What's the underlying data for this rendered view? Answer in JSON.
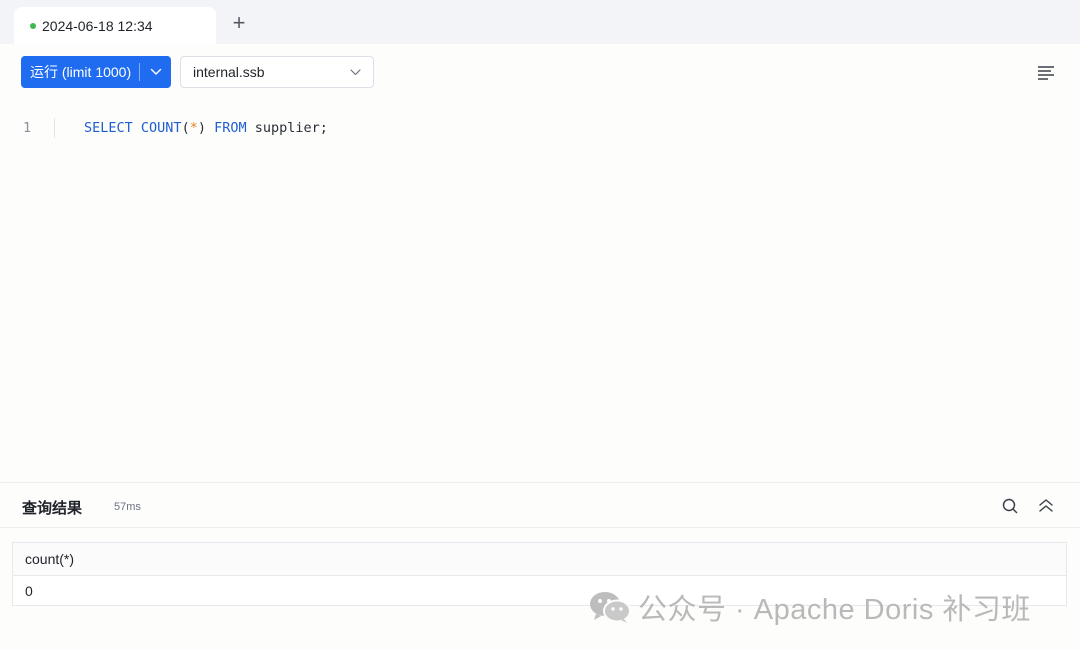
{
  "tabbar": {
    "active_tab_label": "2024-06-18 12:34",
    "add_tab_glyph": "+"
  },
  "toolbar": {
    "run_label": "运行 (limit 1000)",
    "database_value": "internal.ssb"
  },
  "editor": {
    "line_number": "1",
    "tokens": {
      "select": "SELECT",
      "count": "COUNT",
      "open_paren": "(",
      "star": "*",
      "close_paren": ")",
      "from": "FROM",
      "rest": "supplier;"
    }
  },
  "result": {
    "title": "查询结果",
    "elapsed": "57ms",
    "columns": [
      "count(*)"
    ],
    "rows": [
      [
        "0"
      ]
    ]
  },
  "watermark": {
    "text": "公众号 · Apache Doris 补习班"
  },
  "colors": {
    "accent": "#1f6cf0",
    "status_dot": "#3fb950",
    "keyword": "#1f5ed1",
    "star": "#e0852c"
  },
  "icons": {
    "tab_status": "status-dot-icon",
    "add": "plus-icon",
    "run_dropdown": "chevron-down-icon",
    "db_dropdown": "chevron-down-icon",
    "format": "menu-lines-icon",
    "search": "search-icon",
    "collapse": "double-chevron-up-icon",
    "watermark_logo": "wechat-icon"
  }
}
